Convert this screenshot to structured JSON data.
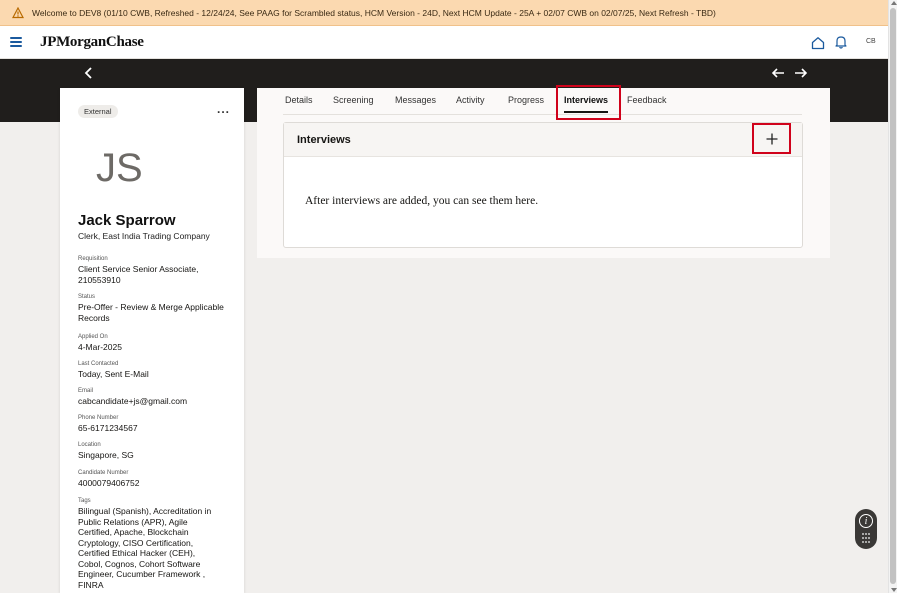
{
  "banner": {
    "text": "Welcome to DEV8 (01/10 CWB, Refreshed - 12/24/24, See PAAG for Scrambled status, HCM Version - 24D, Next HCM Update - 25A + 02/07 CWB on 02/07/25, Next Refresh - TBD)",
    "icon": "warning-icon"
  },
  "header": {
    "logo": "JPMorganChase",
    "user_initials": "CB",
    "icons": [
      "hamburger-menu-icon",
      "home-icon",
      "bell-icon"
    ]
  },
  "candidate": {
    "badge": "External",
    "more": "...",
    "initials": "JS",
    "name": "Jack Sparrow",
    "title": "Clerk, East India Trading Company",
    "fields": [
      {
        "label": "Requisition",
        "value": "Client Service Senior Associate, 210553910"
      },
      {
        "label": "Status",
        "value": "Pre-Offer - Review & Merge Applicable Records"
      },
      {
        "label": "Applied On",
        "value": "4-Mar-2025"
      },
      {
        "label": "Last Contacted",
        "value": "Today, Sent E-Mail"
      },
      {
        "label": "Email",
        "value": "cabcandidate+js@gmail.com"
      },
      {
        "label": "Phone Number",
        "value": "65-6171234567"
      },
      {
        "label": "Location",
        "value": "Singapore, SG"
      },
      {
        "label": "Candidate Number",
        "value": "4000079406752"
      },
      {
        "label": "Tags",
        "value": "Bilingual (Spanish), Accreditation in Public Relations (APR), Agile Certified, Apache, Blockchain Cryptology, CISO Certification, Certified Ethical Hacker (CEH), Cobol, Cognos, Cohort Software Engineer, Cucumber Framework , FINRA"
      }
    ]
  },
  "tabs": [
    {
      "label": "Details"
    },
    {
      "label": "Screening"
    },
    {
      "label": "Messages"
    },
    {
      "label": "Activity"
    },
    {
      "label": "Progress"
    },
    {
      "label": "Interviews",
      "active": true
    },
    {
      "label": "Feedback"
    }
  ],
  "interviews": {
    "title": "Interviews",
    "add_label": "+",
    "empty_message": "After interviews are added, you can see them here."
  },
  "colors": {
    "banner_bg": "#fbd9b0",
    "dark_band": "#201e1c",
    "highlight": "#d0021b",
    "link_blue": "#1b5a9e"
  }
}
